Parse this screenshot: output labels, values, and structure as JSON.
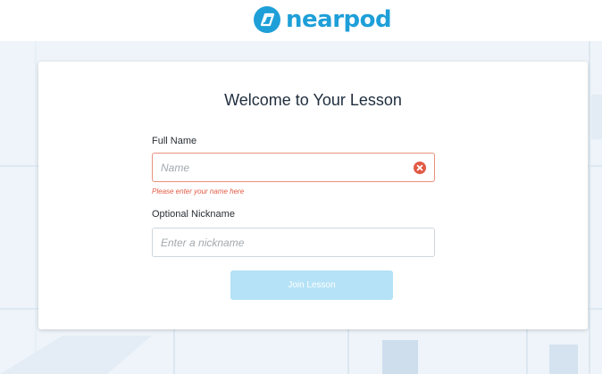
{
  "brand": {
    "name": "nearpod",
    "color": "#1e9fd8"
  },
  "form": {
    "title": "Welcome to Your Lesson",
    "full_name": {
      "label": "Full Name",
      "value": "",
      "placeholder": "Name",
      "error": "Please enter your name here",
      "clear_icon": "close-circle-icon"
    },
    "nickname": {
      "label": "Optional Nickname",
      "value": "",
      "placeholder": "Enter a nickname"
    },
    "join_button": {
      "label": "Join Lesson",
      "enabled": false
    }
  },
  "colors": {
    "error": "#e25a45",
    "button_disabled": "#b5e2f6",
    "background": "#eef4f9"
  }
}
